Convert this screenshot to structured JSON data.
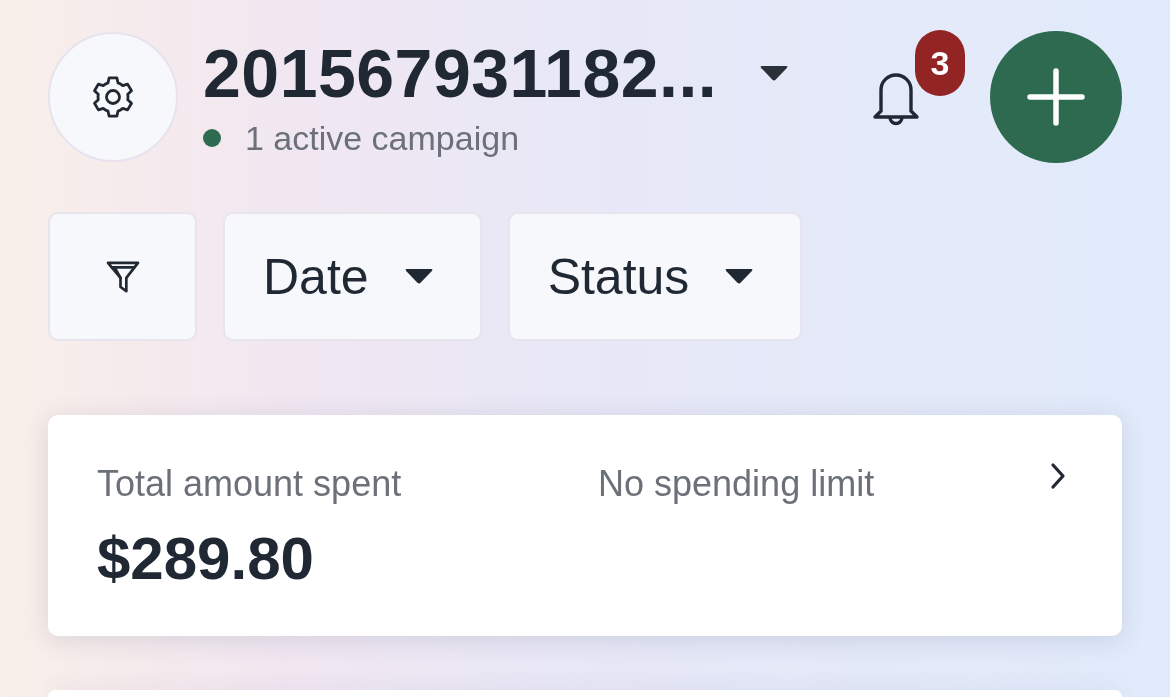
{
  "header": {
    "account_name": "201567931182...",
    "status_text": "1 active campaign",
    "notification_count": "3"
  },
  "filters": [
    {
      "kind": "icon"
    },
    {
      "kind": "dropdown",
      "label": "Date"
    },
    {
      "kind": "dropdown",
      "label": "Status"
    }
  ],
  "spend_card": {
    "label": "Total amount spent",
    "amount": "$289.80",
    "limit": "No spending limit"
  }
}
